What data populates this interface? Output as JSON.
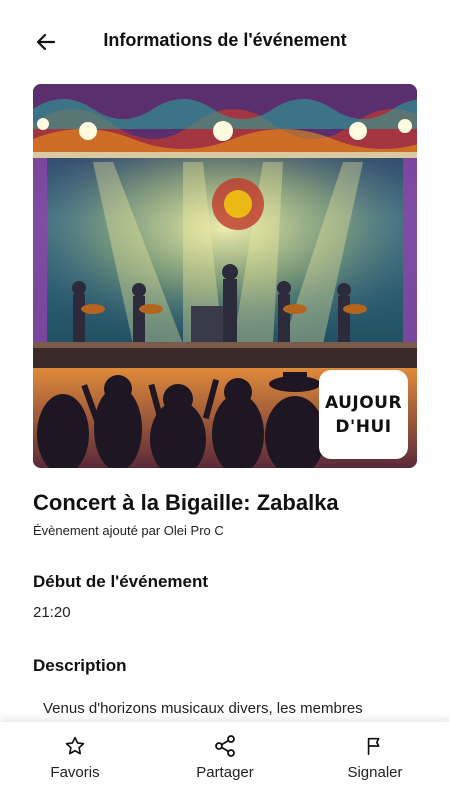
{
  "header": {
    "title": "Informations de l'événement"
  },
  "hero": {
    "badge_text": "AUJOUR D'HUI"
  },
  "event": {
    "title": "Concert à la Bigaille: Zabalka",
    "added_by": "Évènement ajouté par Olei Pro C"
  },
  "start": {
    "heading": "Début de l'événement",
    "time": "21:20"
  },
  "description": {
    "heading": "Description",
    "text": "Venus d'horizons musicaux divers, les membres"
  },
  "bottom_nav": {
    "items": [
      {
        "label": "Favoris",
        "icon": "star-icon"
      },
      {
        "label": "Partager",
        "icon": "share-icon"
      },
      {
        "label": "Signaler",
        "icon": "flag-icon"
      }
    ]
  }
}
